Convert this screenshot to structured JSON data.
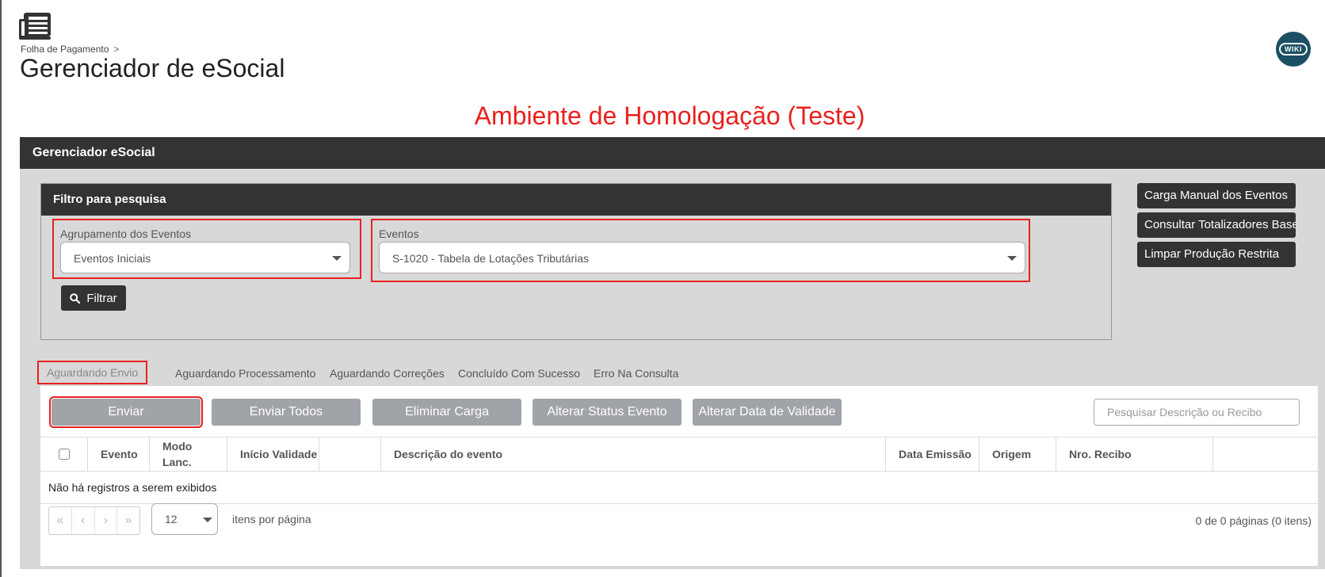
{
  "header": {
    "breadcrumb": "Folha de Pagamento",
    "breadcrumb_sep": ">",
    "title": "Gerenciador de eSocial",
    "wiki_label": "WIKI"
  },
  "environment_banner": "Ambiente de Homologação (Teste)",
  "panel": {
    "title": "Gerenciador eSocial"
  },
  "filter": {
    "title": "Filtro para pesquisa",
    "group_label": "Agrupamento dos Eventos",
    "group_value": "Eventos Iniciais",
    "events_label": "Eventos",
    "events_value": "S-1020 - Tabela de Lotações Tributárias",
    "filter_button": "Filtrar"
  },
  "side_buttons": [
    "Carga Manual dos Eventos",
    "Consultar Totalizadores Base",
    "Limpar Produção Restrita"
  ],
  "tabs": [
    "Aguardando Envio",
    "Aguardando Processamento",
    "Aguardando Correções",
    "Concluído Com Sucesso",
    "Erro Na Consulta"
  ],
  "actions": [
    "Enviar",
    "Enviar Todos",
    "Eliminar Carga",
    "Alterar Status Evento",
    "Alterar Data de Validade"
  ],
  "search": {
    "placeholder": "Pesquisar Descrição ou Recibo"
  },
  "table": {
    "columns": {
      "evento": "Evento",
      "modo_line1": "Modo",
      "modo_line2": "Lanc.",
      "inicio_validade": "Início Validade",
      "blank": "",
      "descricao": "Descrição do evento",
      "data_emissao": "Data Emissão",
      "origem": "Origem",
      "nro_recibo": "Nro. Recibo"
    },
    "empty_message": "Não há registros a serem exibidos"
  },
  "pager": {
    "first": "«",
    "prev": "‹",
    "next": "›",
    "last": "»",
    "page_size": "12",
    "per_page_label": "itens por página",
    "info": "0 de 0 páginas (0 itens)"
  },
  "colors": {
    "accent_red": "#e8211f",
    "dark": "#333333",
    "button_gray": "#a0a3a8",
    "panel_bg": "#d8d8d8",
    "wiki_bg": "#1b4f63"
  }
}
